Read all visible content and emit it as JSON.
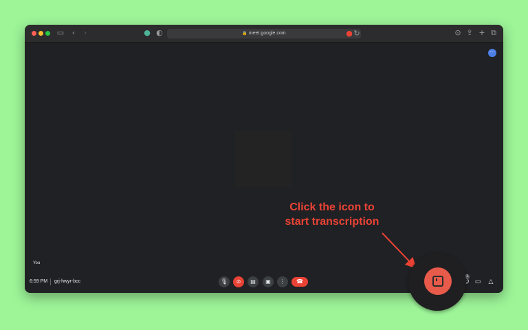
{
  "browser": {
    "url": "meet.google.com",
    "icons": [
      "sidebar-icon",
      "back-icon",
      "forward-icon",
      "privacy-icon",
      "shield-icon",
      "mic-indicator-icon",
      "reload-icon",
      "download-icon",
      "share-icon",
      "new-tab-icon",
      "tabs-overview-icon"
    ]
  },
  "meeting": {
    "self_label": "You",
    "time": "6:59 PM",
    "code": "grj-hwyr-bcc",
    "people_count": "1"
  },
  "controls": [
    "microphone-button",
    "camera-off-button",
    "captions-button",
    "present-button",
    "more-options-button",
    "leave-call-button"
  ],
  "annotation": {
    "line1": "Click the icon to",
    "line2": "start transcription"
  },
  "colors": {
    "background": "#9df598",
    "accent": "#ea4335",
    "window": "#202124"
  }
}
